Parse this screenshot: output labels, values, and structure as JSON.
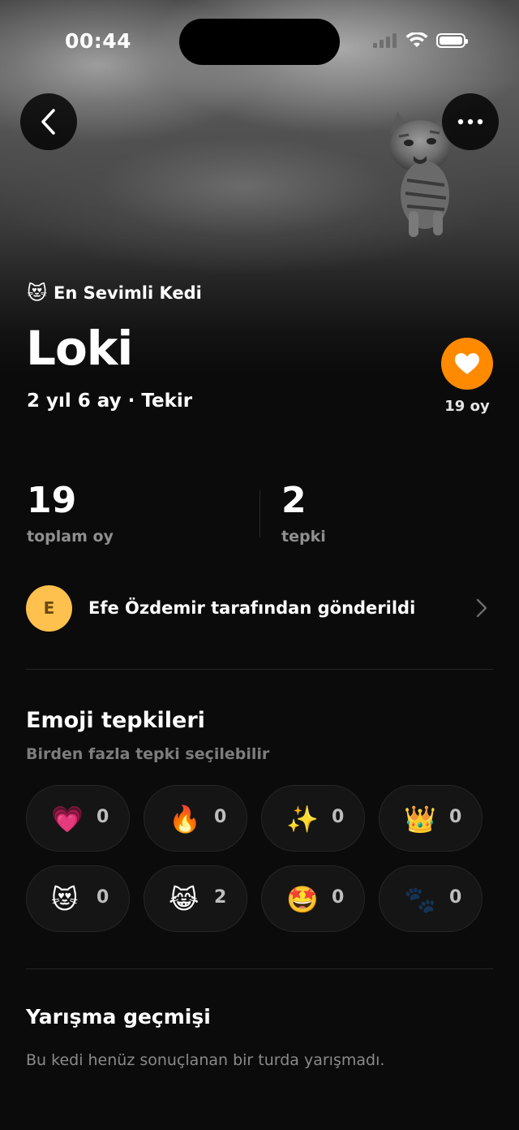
{
  "status_bar": {
    "time": "00:44"
  },
  "badge": {
    "emoji": "😻",
    "label": "En Sevimli Kedi"
  },
  "cat": {
    "name": "Loki",
    "meta": "2 yıl 6 ay · Tekir"
  },
  "vote": {
    "count_label": "19 oy"
  },
  "stats": [
    {
      "value": "19",
      "label": "toplam oy"
    },
    {
      "value": "2",
      "label": "tepki"
    }
  ],
  "submitter": {
    "initial": "E",
    "text": "Efe Özdemir tarafından gönderildi"
  },
  "reactions": {
    "title": "Emoji tepkileri",
    "subtitle": "Birden fazla tepki seçilebilir",
    "items": [
      {
        "emoji": "💗",
        "count": "0"
      },
      {
        "emoji": "🔥",
        "count": "0"
      },
      {
        "emoji": "✨",
        "count": "0"
      },
      {
        "emoji": "👑",
        "count": "0"
      },
      {
        "emoji": "😻",
        "count": "0"
      },
      {
        "emoji": "😹",
        "count": "2"
      },
      {
        "emoji": "🤩",
        "count": "0"
      },
      {
        "emoji": "🐾",
        "count": "0"
      }
    ]
  },
  "history": {
    "title": "Yarışma geçmişi",
    "empty_text": "Bu kedi henüz sonuçlanan bir turda yarışmadı."
  },
  "colors": {
    "accent": "#ff8a00",
    "avatar": "#ffc14d",
    "background": "#0b0b0b"
  }
}
